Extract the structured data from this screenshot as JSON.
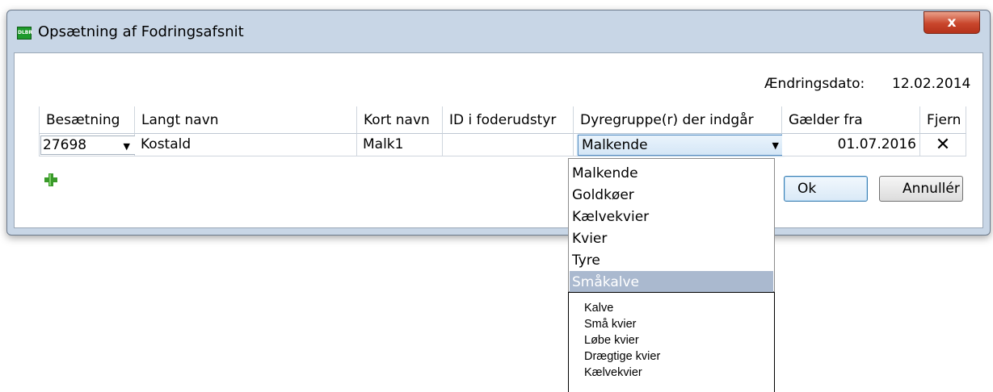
{
  "window": {
    "app_icon_text": "DLBR",
    "title": "Opsætning af Fodringsafsnit",
    "close_glyph": "x"
  },
  "change_date": {
    "label": "Ændringsdato:",
    "value": "12.02.2014"
  },
  "grid": {
    "headers": [
      "Besætning",
      "Langt navn",
      "Kort navn",
      "ID i foderudstyr",
      "Dyregruppe(r) der indgår",
      "Gælder fra",
      "Fjern"
    ],
    "row": {
      "besaetning": "27698",
      "langt_navn": "Kostald",
      "kort_navn": "Malk1",
      "id_foderudstyr": "",
      "dyregruppe": "Malkende",
      "gaelder_fra": "01.07.2016",
      "fjern_glyph": "✕"
    }
  },
  "add_icon": "plus-icon",
  "buttons": {
    "ok": "Ok",
    "cancel": "Annullér"
  },
  "dropdown": {
    "items": [
      "Malkende",
      "Goldkøer",
      "Kælvekvier",
      "Kvier",
      "Tyre",
      "Småkalve"
    ],
    "highlighted": "Småkalve"
  },
  "tooltip_list": {
    "items": [
      "Kalve",
      "Små kvier",
      "Løbe kvier",
      "Drægtige kvier",
      "Kælvekvier"
    ]
  },
  "colors": {
    "frame": "#c8d6e6",
    "highlight": "#aab9cf",
    "focus_border": "#5b8fc2",
    "close_red": "#c9462c",
    "add_green": "#3a9a2a"
  }
}
